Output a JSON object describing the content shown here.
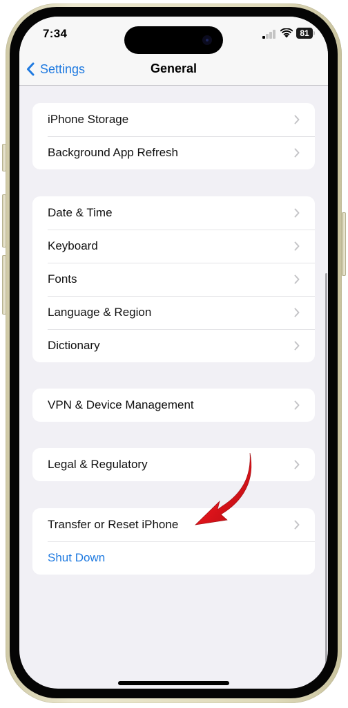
{
  "status_bar": {
    "time": "7:34",
    "signal_bars_active": 1,
    "signal_bars_total": 4,
    "wifi": "wifi-icon",
    "battery_percent": "81"
  },
  "nav": {
    "back_label": "Settings",
    "title": "General"
  },
  "groups": [
    {
      "rows": [
        {
          "label": "iPhone Storage"
        },
        {
          "label": "Background App Refresh"
        }
      ]
    },
    {
      "rows": [
        {
          "label": "Date & Time"
        },
        {
          "label": "Keyboard"
        },
        {
          "label": "Fonts"
        },
        {
          "label": "Language & Region"
        },
        {
          "label": "Dictionary"
        }
      ]
    },
    {
      "rows": [
        {
          "label": "VPN & Device Management"
        }
      ]
    },
    {
      "rows": [
        {
          "label": "Legal & Regulatory"
        }
      ]
    },
    {
      "rows": [
        {
          "label": "Transfer or Reset iPhone"
        },
        {
          "label": "Shut Down"
        }
      ]
    }
  ],
  "colors": {
    "accent": "#1f7ae0",
    "background": "#f1f0f5",
    "annotation_arrow": "#e0141b"
  },
  "annotation": {
    "type": "red-curved-arrow",
    "points_to": "Transfer or Reset iPhone"
  }
}
